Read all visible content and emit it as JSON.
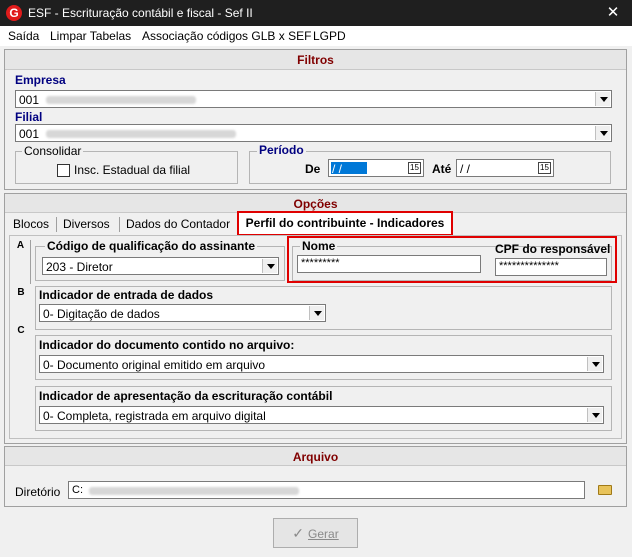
{
  "window": {
    "title": "ESF - Escrituração contábil e fiscal - Sef II",
    "close": "✕"
  },
  "menu": [
    "Saída",
    "Limpar Tabelas",
    "Associação códigos GLB x SEF",
    "LGPD"
  ],
  "filtros": {
    "title": "Filtros",
    "empresa_label": "Empresa",
    "empresa_value": "001",
    "filial_label": "Filial",
    "filial_value": "001",
    "consolidar_label": "Consolidar",
    "insc_label": "Insc. Estadual da filial",
    "periodo_label": "Período",
    "de_label": "De",
    "de_value": "/ /",
    "ate_label": "Até",
    "ate_value": "/ /",
    "cal_glyph": "15"
  },
  "opcoes": {
    "title": "Opções",
    "tabs": [
      "Blocos",
      "Diversos",
      "Dados do Contador",
      "Perfil do contribuinte - Indicadores"
    ],
    "vtabs": [
      "A",
      "B",
      "C"
    ],
    "codigo_label": "Código de qualificação do assinante",
    "codigo_value": "203 - Diretor",
    "nome_label": "Nome",
    "nome_value": "*********",
    "cpf_label": "CPF do responsável",
    "cpf_value": "**************",
    "entrada_label": "Indicador de entrada de dados",
    "entrada_value": "0- Digitação de dados",
    "documento_label": "Indicador do documento contido no arquivo:",
    "documento_value": "0- Documento original emitido em arquivo",
    "apresentacao_label": "Indicador de apresentação da escrituração contábil",
    "apresentacao_value": "0- Completa, registrada em arquivo digital"
  },
  "arquivo": {
    "title": "Arquivo",
    "diretorio_label": "Diretório",
    "diretorio_value": "C:"
  },
  "gerar_label": "Gerar",
  "gerar_glyph": "✓"
}
